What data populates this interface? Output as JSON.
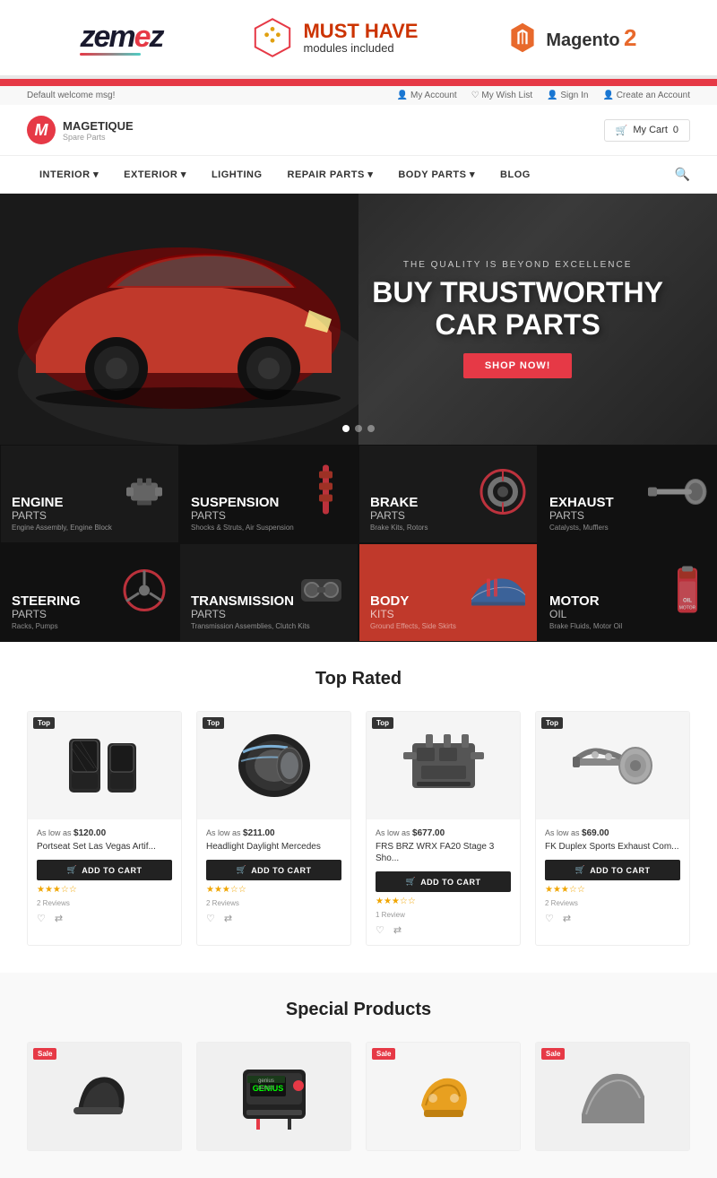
{
  "topBanner": {
    "zemes": {
      "text1": "zem",
      "text2": "e",
      "text3": "z"
    },
    "musthave": {
      "line1": "MUST HAVE",
      "line2": "modules included"
    },
    "magento": {
      "label": "Magento",
      "version": "2"
    }
  },
  "store": {
    "topbar": {
      "welcome": "Default welcome msg!",
      "links": [
        "My Account",
        "My Wish List",
        "Sign In",
        "Create an Account"
      ]
    },
    "logo": {
      "initial": "M",
      "name": "MAGETIQUE",
      "tagline": "Spare Parts"
    },
    "cart": {
      "label": "My Cart",
      "count": "0"
    },
    "menu": {
      "items": [
        "INTERIOR",
        "EXTERIOR",
        "LIGHTING",
        "REPAIR PARTS",
        "BODY PARTS",
        "BLOG"
      ]
    }
  },
  "hero": {
    "subtitle": "THE QUALITY IS BEYOND EXCELLENCE",
    "title1": "BUY TRUSTWORTHY",
    "title2": "CAR PARTS",
    "cta": "SHOP NOW!"
  },
  "categories": [
    {
      "title": "ENGINE",
      "subtitle": "PARTS",
      "desc": "Engine Assembly, Engine Block",
      "bg": "dark",
      "icon": "⚙"
    },
    {
      "title": "SUSPENSION",
      "subtitle": "PARTS",
      "desc": "Shocks & Struts, Air Suspension",
      "bg": "dark",
      "icon": "🔧"
    },
    {
      "title": "BRAKE",
      "subtitle": "PARTS",
      "desc": "Brake Kits, Rotors",
      "bg": "dark",
      "icon": "⭕"
    },
    {
      "title": "EXHAUST",
      "subtitle": "PARTS",
      "desc": "Catalysts, Mufflers",
      "bg": "dark",
      "icon": "〰"
    },
    {
      "title": "STEERING",
      "subtitle": "PARTS",
      "desc": "Racks, Pumps",
      "bg": "dark",
      "icon": "🔩"
    },
    {
      "title": "TRANSMISSION",
      "subtitle": "PARTS",
      "desc": "Transmission Assemblies, Clutch Kits",
      "bg": "dark",
      "icon": "⚙"
    },
    {
      "title": "BODY",
      "subtitle": "KITS",
      "desc": "Ground Effects, Side Skirts",
      "bg": "red",
      "icon": "🚗"
    },
    {
      "title": "MOTOR",
      "subtitle": "OIL",
      "desc": "Brake Fluids, Motor Oil",
      "bg": "dark",
      "icon": "🛢"
    }
  ],
  "topRated": {
    "title": "Top Rated",
    "products": [
      {
        "badge": "Top",
        "price": "As low as $120.00",
        "name": "Portseat Set Las Vegas Artif...",
        "stars": 3,
        "reviews": "2 Reviews",
        "color": "#3a3a3a"
      },
      {
        "badge": "Top",
        "price": "As low as $211.00",
        "name": "Headlight Daylight Mercedes",
        "stars": 3,
        "reviews": "2 Reviews",
        "color": "#555"
      },
      {
        "badge": "Top",
        "price": "As low as $677.00",
        "name": "FRS BRZ WRX FA20 Stage 3 Sho...",
        "stars": 3,
        "reviews": "1 Review",
        "color": "#444"
      },
      {
        "badge": "Top",
        "price": "As low as $69.00",
        "name": "FK Duplex Sports Exhaust Com...",
        "stars": 3,
        "reviews": "2 Reviews",
        "color": "#666"
      }
    ]
  },
  "specialProducts": {
    "title": "Special Products",
    "products": [
      {
        "badge": "Sale",
        "color": "#222"
      },
      {
        "badge": "",
        "color": "#333"
      },
      {
        "badge": "Sale",
        "color": "#444"
      },
      {
        "badge": "Sale",
        "color": "#555"
      }
    ]
  },
  "ui": {
    "addToCart": "ADD TO CART",
    "cartIcon": "🛒",
    "heartIcon": "♡",
    "compareIcon": "⇄",
    "searchIcon": "🔍"
  }
}
